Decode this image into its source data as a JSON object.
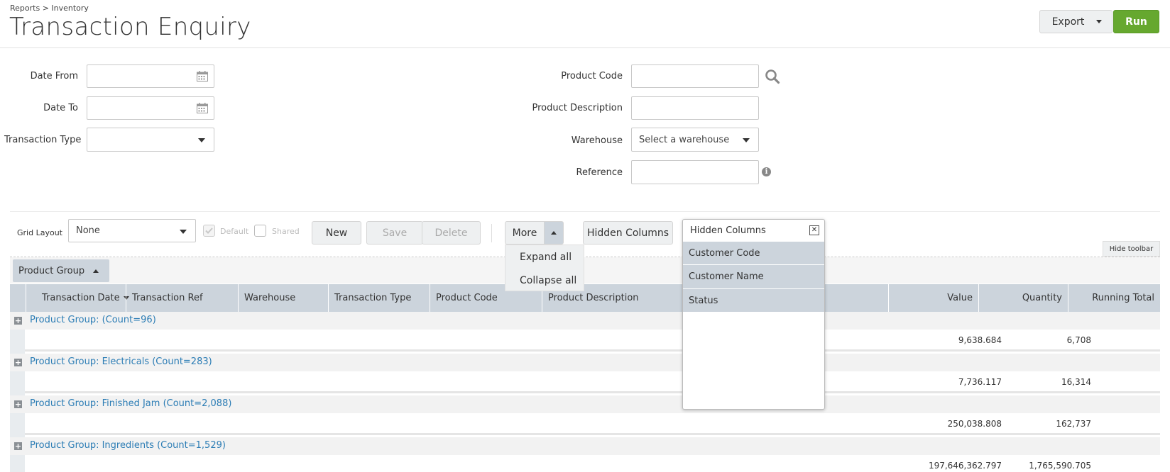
{
  "header": {
    "breadcrumb": "Reports > Inventory",
    "title": "Transaction Enquiry",
    "export_label": "Export",
    "run_label": "Run"
  },
  "filters": {
    "date_from_label": "Date From",
    "date_to_label": "Date To",
    "transaction_type_label": "Transaction Type",
    "product_code_label": "Product Code",
    "product_description_label": "Product Description",
    "warehouse_label": "Warehouse",
    "warehouse_value": "Select a warehouse",
    "reference_label": "Reference"
  },
  "toolbar": {
    "grid_layout_label": "Grid Layout",
    "grid_layout_value": "None",
    "default_label": "Default",
    "shared_label": "Shared",
    "new_label": "New",
    "save_label": "Save",
    "delete_label": "Delete",
    "more_label": "More",
    "hidden_columns_label": "Hidden Columns",
    "hide_toolbar_label": "Hide toolbar"
  },
  "more_menu": {
    "items": [
      "Expand all",
      "Collapse all"
    ]
  },
  "grouping": {
    "chip_label": "Product Group"
  },
  "grid": {
    "columns": [
      "Transaction Date",
      "Transaction Ref",
      "Warehouse",
      "Transaction Type",
      "Product Code",
      "Product Description",
      "Value",
      "Quantity",
      "Running Total"
    ],
    "groups": [
      {
        "label": "Product Group: (Count=96)",
        "value": "9,638.684",
        "quantity": "6,708"
      },
      {
        "label": "Product Group: Electricals (Count=283)",
        "value": "7,736.117",
        "quantity": "16,314"
      },
      {
        "label": "Product Group: Finished Jam (Count=2,088)",
        "value": "250,038.808",
        "quantity": "162,737"
      },
      {
        "label": "Product Group: Ingredients (Count=1,529)",
        "value": "197,646,362.797",
        "quantity": "1,765,590.705"
      }
    ]
  },
  "hidden_columns_panel": {
    "title": "Hidden Columns",
    "items": [
      "Customer Code",
      "Customer Name",
      "Status"
    ]
  }
}
